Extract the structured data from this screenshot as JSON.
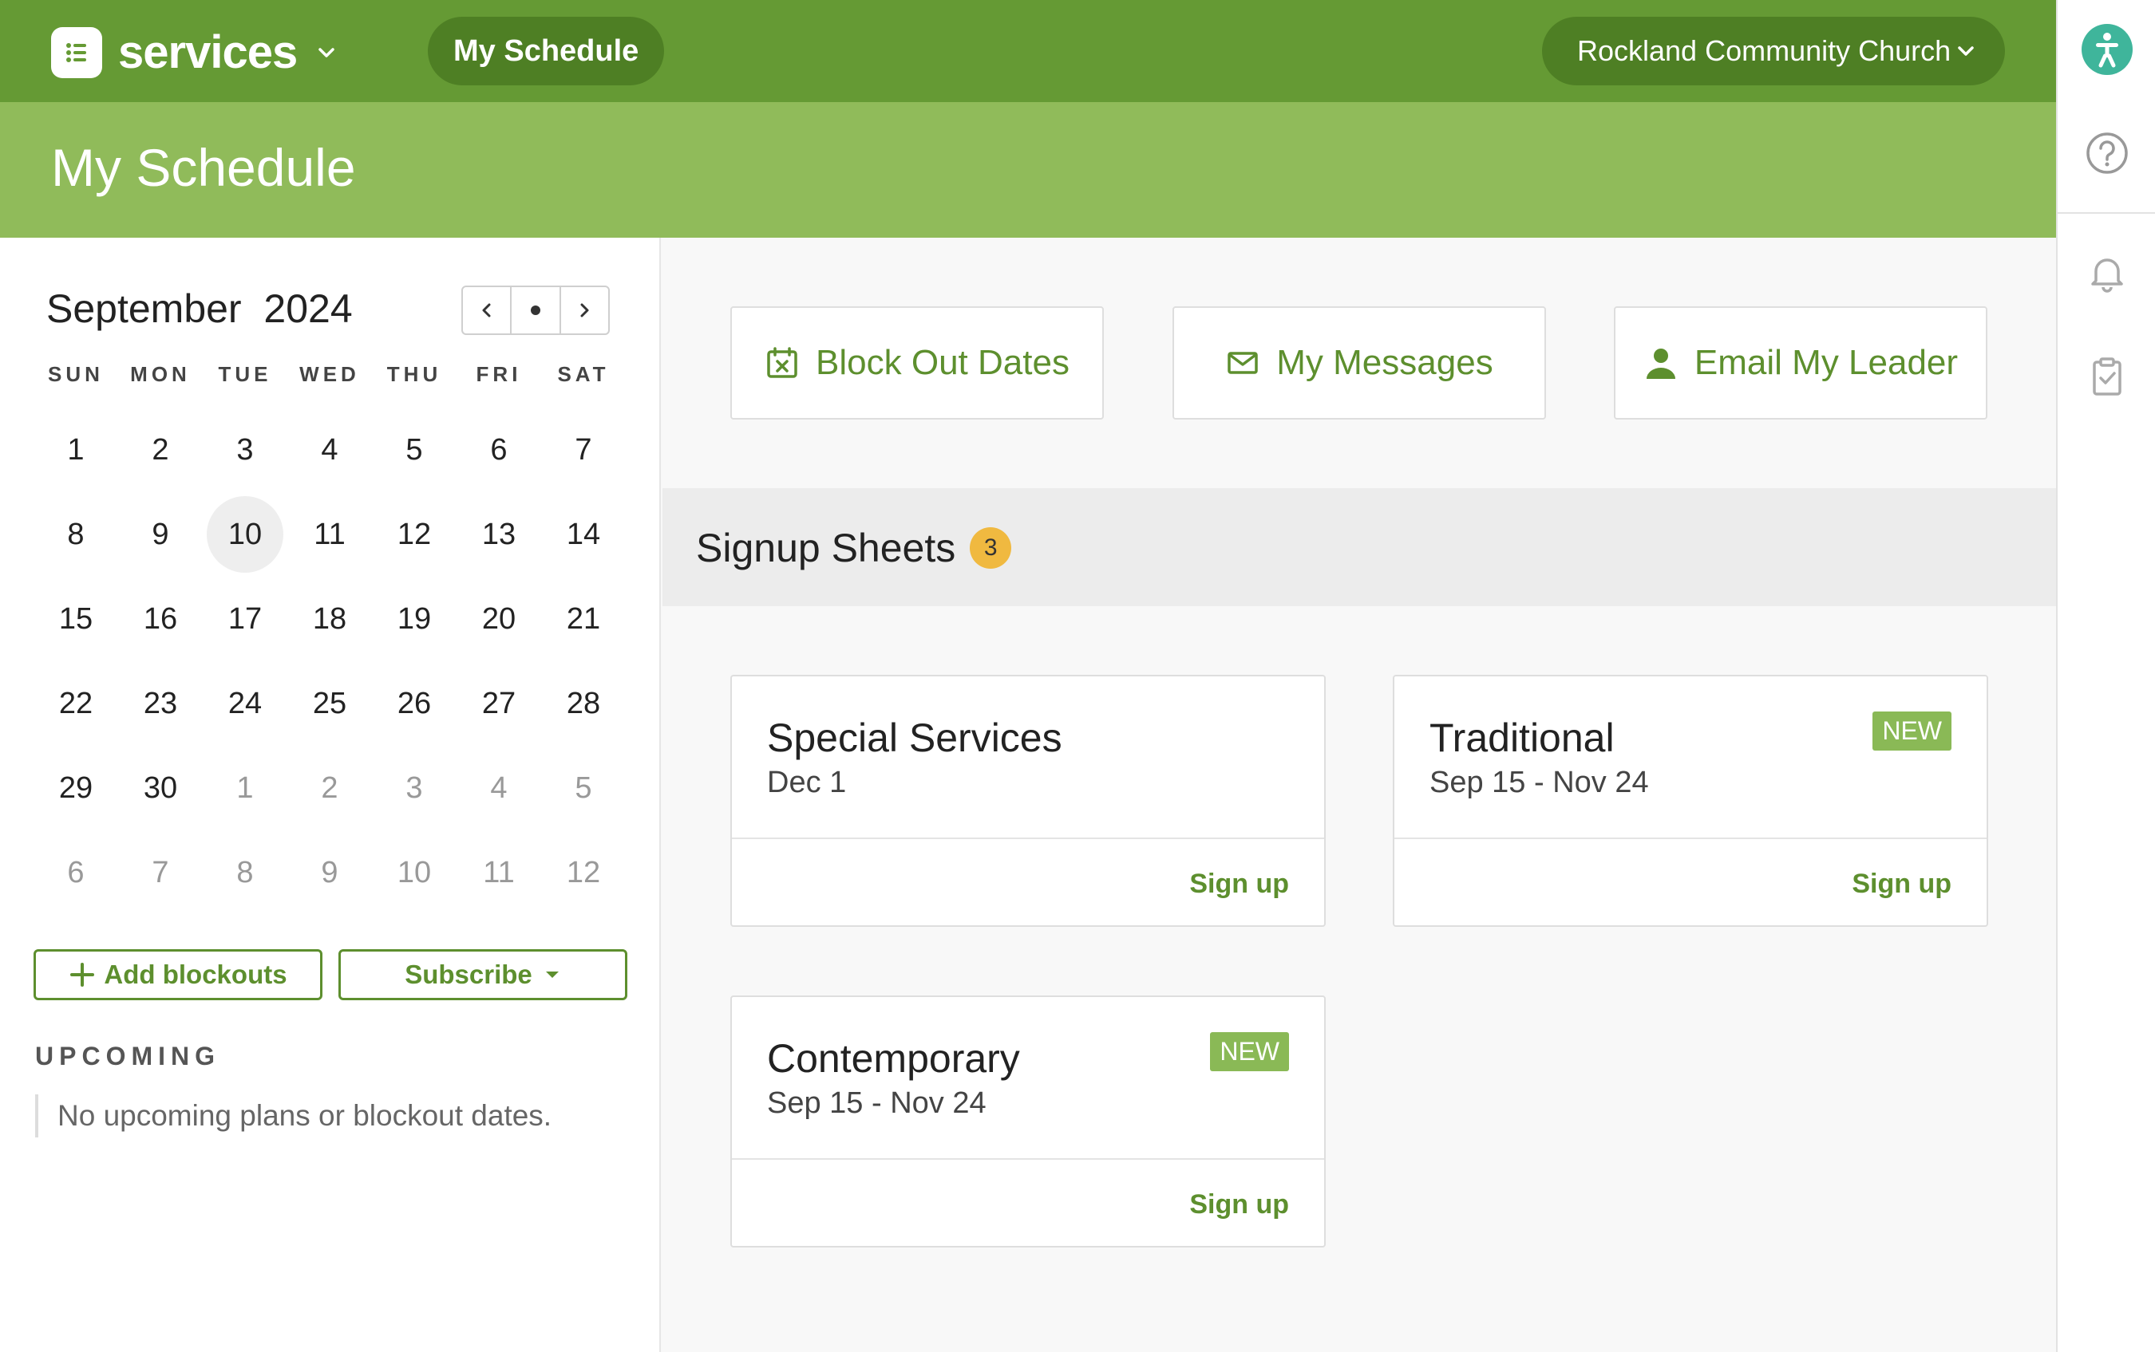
{
  "topbar": {
    "app_name": "services",
    "active_tab": "My Schedule",
    "organization": "Rockland Community Church"
  },
  "header": {
    "title": "My Schedule"
  },
  "calendar": {
    "month": "September",
    "year": "2024",
    "weekdays": [
      "SUN",
      "MON",
      "TUE",
      "WED",
      "THU",
      "FRI",
      "SAT"
    ],
    "weeks": [
      [
        "1",
        "2",
        "3",
        "4",
        "5",
        "6",
        "7"
      ],
      [
        "8",
        "9",
        "10",
        "11",
        "12",
        "13",
        "14"
      ],
      [
        "15",
        "16",
        "17",
        "18",
        "19",
        "20",
        "21"
      ],
      [
        "22",
        "23",
        "24",
        "25",
        "26",
        "27",
        "28"
      ],
      [
        "29",
        "30",
        "1",
        "2",
        "3",
        "4",
        "5"
      ],
      [
        "6",
        "7",
        "8",
        "9",
        "10",
        "11",
        "12"
      ]
    ],
    "today": "10"
  },
  "sidebar": {
    "add_blockouts": "Add blockouts",
    "subscribe": "Subscribe",
    "upcoming_label": "UPCOMING",
    "upcoming_empty": "No upcoming plans or blockout dates."
  },
  "actions": {
    "block_out": "Block Out Dates",
    "messages": "My Messages",
    "email_leader": "Email My Leader"
  },
  "signup": {
    "title": "Signup Sheets",
    "count": "3",
    "cards": [
      {
        "title": "Special Services",
        "dates": "Dec 1",
        "new": "",
        "link": "Sign up"
      },
      {
        "title": "Traditional",
        "dates": "Sep 15 - Nov 24",
        "new": "NEW",
        "link": "Sign up"
      },
      {
        "title": "Contemporary",
        "dates": "Sep 15 - Nov 24",
        "new": "NEW",
        "link": "Sign up"
      }
    ]
  },
  "colors": {
    "topbar": "#659a34",
    "header": "#90bb5a",
    "accent": "#5d8f2e",
    "badge": "#f0b940",
    "new_badge": "#8ab956"
  },
  "icons": {
    "rail": [
      "person-icon",
      "help-icon",
      "bell-icon",
      "clipboard-check-icon"
    ]
  }
}
